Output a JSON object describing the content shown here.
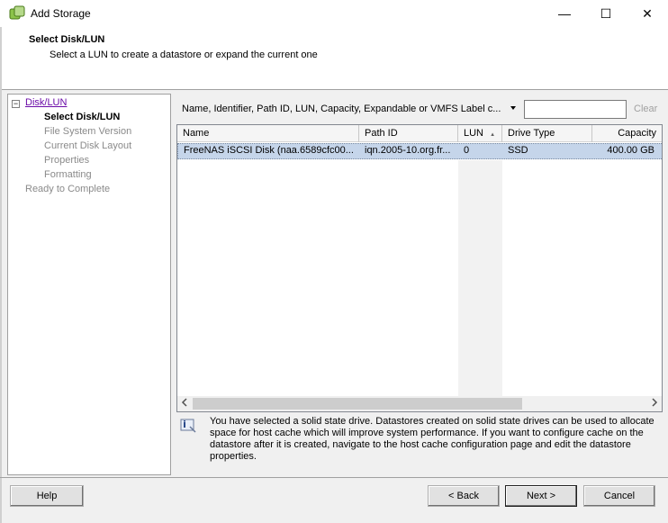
{
  "window": {
    "title": "Add Storage",
    "minimize_glyph": "—",
    "maximize_glyph": "☐",
    "close_glyph": "✕"
  },
  "header": {
    "title": "Select Disk/LUN",
    "subtitle": "Select a LUN to create a datastore or expand the current one"
  },
  "nav": {
    "toggle": "−",
    "parent": "Disk/LUN",
    "current": "Select Disk/LUN",
    "items": [
      "File System Version",
      "Current Disk Layout",
      "Properties",
      "Formatting"
    ],
    "final": "Ready to Complete"
  },
  "filter": {
    "label": "Name, Identifier, Path ID, LUN, Capacity, Expandable or VMFS Label c...",
    "input_value": "",
    "clear_label": "Clear"
  },
  "table": {
    "columns": [
      "Name",
      "Path ID",
      "LUN",
      "Drive Type",
      "Capacity"
    ],
    "sort_indicator": "▲",
    "rows": [
      {
        "name": "FreeNAS iSCSI Disk (naa.6589cfc00...",
        "path_id": "iqn.2005-10.org.fr...",
        "lun": "0",
        "drive_type": "SSD",
        "capacity": "400.00 GB"
      }
    ]
  },
  "info": {
    "message": "You have selected a solid state drive. Datastores created on solid state drives can be used to allocate space for host cache which will improve system performance. If you want to configure cache on the datastore after it is created, navigate to the host cache configuration page and edit the datastore properties."
  },
  "buttons": {
    "help": "Help",
    "back": "< Back",
    "next": "Next >",
    "cancel": "Cancel"
  },
  "colors": {
    "link": "#6b0ba8",
    "selected_row": "#c5d5ea",
    "disabled_text": "#8a8a8a"
  }
}
